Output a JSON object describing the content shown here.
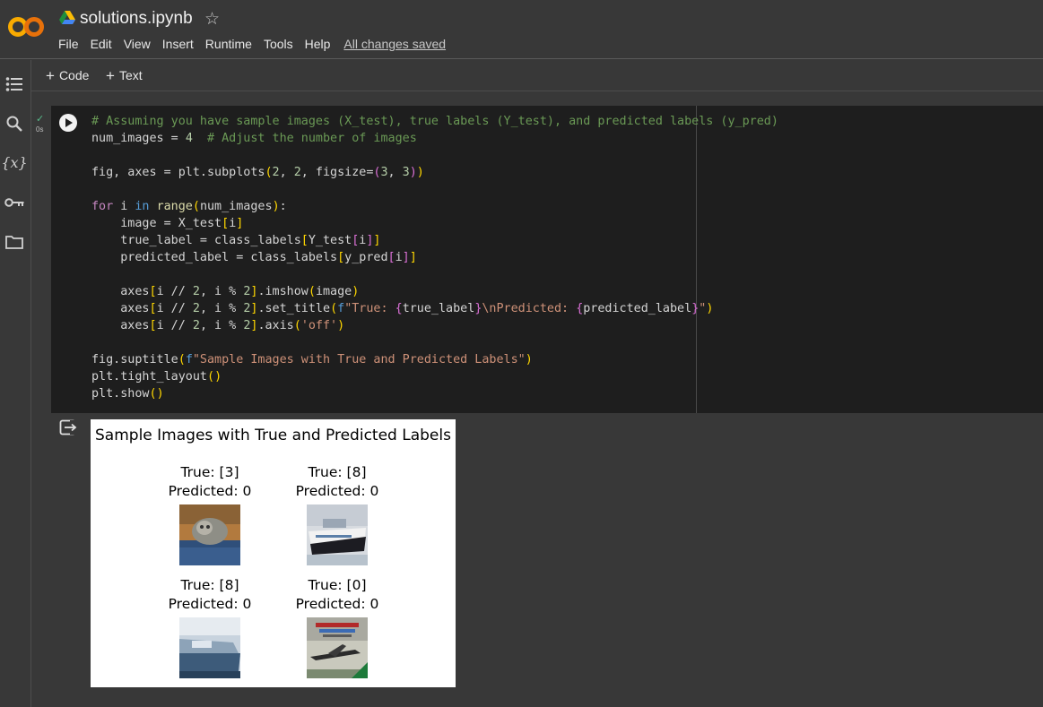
{
  "app": {
    "title": "solutions.ipynb",
    "menu": [
      "File",
      "Edit",
      "View",
      "Insert",
      "Runtime",
      "Tools",
      "Help"
    ],
    "save_status": "All changes saved"
  },
  "toolbar": {
    "code_label": "Code",
    "text_label": "Text"
  },
  "sidebar": {
    "items": [
      "table-of-contents-icon",
      "search-icon",
      "variables-icon",
      "secrets-key-icon",
      "files-folder-icon"
    ]
  },
  "cell": {
    "exec_time": "0s",
    "code_lines": [
      "# Assuming you have sample images (X_test), true labels (Y_test), and predicted labels (y_pred)",
      "num_images = 4  # Adjust the number of images",
      "",
      "fig, axes = plt.subplots(2, 2, figsize=(3, 3))",
      "",
      "for i in range(num_images):",
      "    image = X_test[i]",
      "    true_label = class_labels[Y_test[i]]",
      "    predicted_label = class_labels[y_pred[i]]",
      "",
      "    axes[i // 2, i % 2].imshow(image)",
      "    axes[i // 2, i % 2].set_title(f\"True: {true_label}\\nPredicted: {predicted_label}\")",
      "    axes[i // 2, i % 2].axis('off')",
      "",
      "fig.suptitle(f\"Sample Images with True and Predicted Labels\")",
      "plt.tight_layout()",
      "plt.show()"
    ]
  },
  "output": {
    "suptitle": "Sample Images with True and Predicted Labels",
    "subplots": [
      {
        "true": "True: [3]",
        "pred": "Predicted: 0",
        "image": "cat"
      },
      {
        "true": "True: [8]",
        "pred": "Predicted: 0",
        "image": "ship"
      },
      {
        "true": "True: [8]",
        "pred": "Predicted: 0",
        "image": "ship"
      },
      {
        "true": "True: [0]",
        "pred": "Predicted: 0",
        "image": "airplane"
      }
    ]
  },
  "colors": {
    "accent_check": "#57bb8a",
    "logo_orange": "#f9ab00",
    "logo_dark_orange": "#e8710a"
  }
}
